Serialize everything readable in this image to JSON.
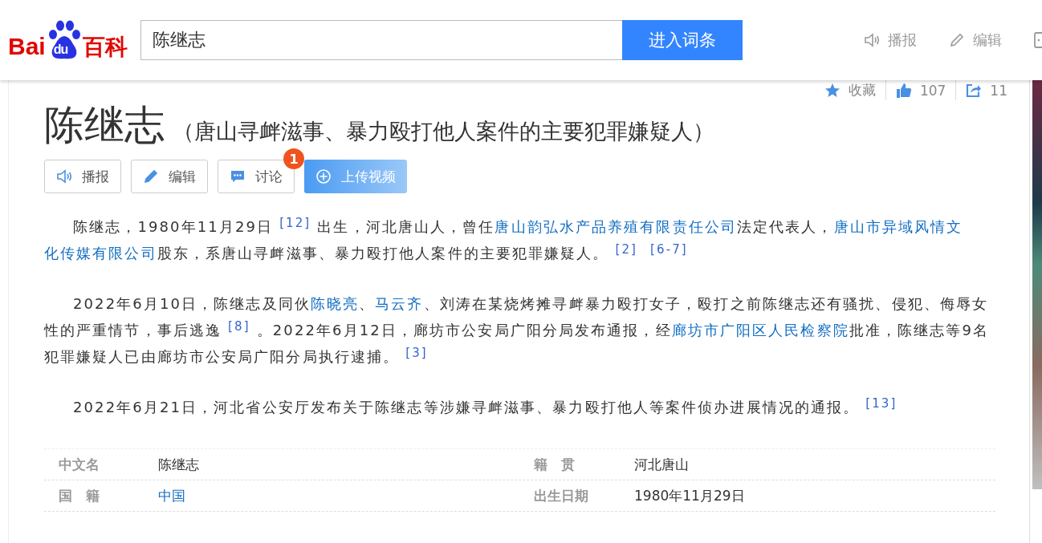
{
  "header": {
    "logo": {
      "left": "Bai",
      "paw": "du",
      "right": "百科"
    },
    "search": {
      "value": "陈继志"
    },
    "search_button": "进入词条",
    "actions": [
      {
        "kind": "speaker",
        "label": "播报"
      },
      {
        "kind": "pencil",
        "label": "编辑"
      },
      {
        "kind": "cut"
      }
    ]
  },
  "toolbar": [
    {
      "kind": "star",
      "label": "收藏"
    },
    {
      "kind": "like",
      "label": "107"
    },
    {
      "kind": "share",
      "label": "11"
    }
  ],
  "title": "陈继志",
  "subtitle": "（唐山寻衅滋事、暴力殴打他人案件的主要犯罪嫌疑人）",
  "buttons": [
    {
      "kind": "speaker",
      "label": "播报"
    },
    {
      "kind": "pencil",
      "label": "编辑"
    },
    {
      "kind": "chat",
      "label": "讨论",
      "badge": "1"
    },
    {
      "kind": "upload",
      "label": "上传视频"
    }
  ],
  "paragraphs": [
    [
      {
        "kind": "text",
        "text": "陈继志，1980年11月29日"
      },
      {
        "kind": "ref",
        "text": "[12]"
      },
      {
        "kind": "text",
        "text": "出生，河北唐山人，曾任"
      },
      {
        "kind": "link",
        "text": "唐山韵弘水产品养殖有限责任公司"
      },
      {
        "kind": "text",
        "text": "法定代表人，"
      },
      {
        "kind": "link",
        "text": "唐山市异域风情文"
      },
      {
        "kind": "link",
        "text": "化传媒有限公司"
      },
      {
        "kind": "text",
        "text": "股东，系唐山寻衅滋事、暴力殴打他人案件的主要犯罪嫌疑人。"
      },
      {
        "kind": "ref",
        "text": "[2]"
      },
      {
        "kind": "ref",
        "text": "[6-7]"
      }
    ],
    [
      {
        "kind": "text",
        "text": "2022年6月10日，陈继志及同伙"
      },
      {
        "kind": "link",
        "text": "陈晓亮"
      },
      {
        "kind": "text",
        "text": "、"
      },
      {
        "kind": "link",
        "text": "马云齐"
      },
      {
        "kind": "text",
        "text": "、刘涛在某烧烤摊寻衅暴力殴打女子，殴打之前陈继志还有骚扰、侵犯、侮辱女性的严重情节，事后逃逸"
      },
      {
        "kind": "ref",
        "text": "[8]"
      },
      {
        "kind": "text",
        "text": "。2022年6月12日，廊坊市公安局广阳分局发布通报，经"
      },
      {
        "kind": "link",
        "text": "廊坊市广阳区人民检察院"
      },
      {
        "kind": "text",
        "text": "批准，陈继志等9名犯罪嫌疑人已由廊坊市公安局广阳分局执行逮捕。"
      },
      {
        "kind": "ref",
        "text": "[3]"
      }
    ],
    [
      {
        "kind": "text",
        "text": "2022年6月21日，河北省公安厅发布关于陈继志等涉嫌寻衅滋事、暴力殴打他人等案件侦办进展情况的通报。"
      },
      {
        "kind": "ref",
        "text": "[13]"
      }
    ]
  ],
  "info": [
    [
      {
        "label": "中文名",
        "value": "陈继志",
        "link": false
      },
      {
        "label": "籍　贯",
        "value": "河北唐山",
        "link": false
      }
    ],
    [
      {
        "label": "国　籍",
        "value": "中国",
        "link": true
      },
      {
        "label": "出生日期",
        "value": "1980年11月29日",
        "link": false
      }
    ]
  ]
}
